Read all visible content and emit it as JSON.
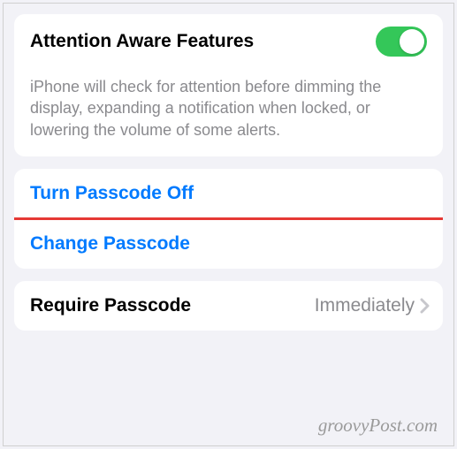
{
  "attention": {
    "title": "Attention Aware Features",
    "toggle_on": true,
    "description": "iPhone will check for attention before dimming the display, expanding a notification when locked, or lowering the volume of some alerts."
  },
  "passcode": {
    "turn_off_label": "Turn Passcode Off",
    "change_label": "Change Passcode"
  },
  "require": {
    "label": "Require Passcode",
    "value": "Immediately"
  },
  "watermark": "groovyPost.com"
}
